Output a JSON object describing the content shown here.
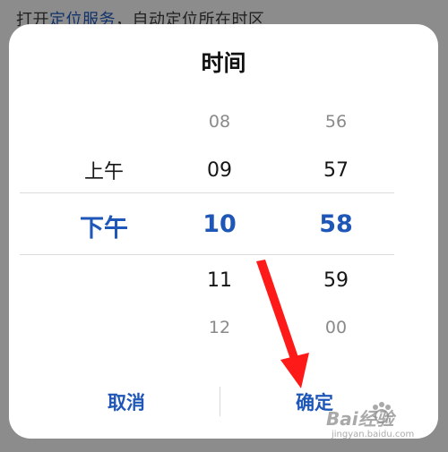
{
  "background": {
    "hint_prefix": "打开",
    "hint_link": "定位服务",
    "hint_suffix": "，自动定位所在时区"
  },
  "dialog": {
    "title": "时间",
    "ampm": [
      "上午",
      "下午"
    ],
    "ampm_selected": "下午",
    "hours": [
      "08",
      "09",
      "10",
      "11",
      "12"
    ],
    "hour_selected": "10",
    "minutes": [
      "56",
      "57",
      "58",
      "59",
      "00"
    ],
    "minute_selected": "58",
    "cancel_label": "取消",
    "confirm_label": "确定"
  },
  "colors": {
    "accent": "#1f57b8",
    "annotation_arrow": "#ff1a1a"
  },
  "watermark": {
    "main": "Bai经验",
    "sub": "jingyan.baidu.com",
    "icon": "baidu-paw-icon"
  }
}
